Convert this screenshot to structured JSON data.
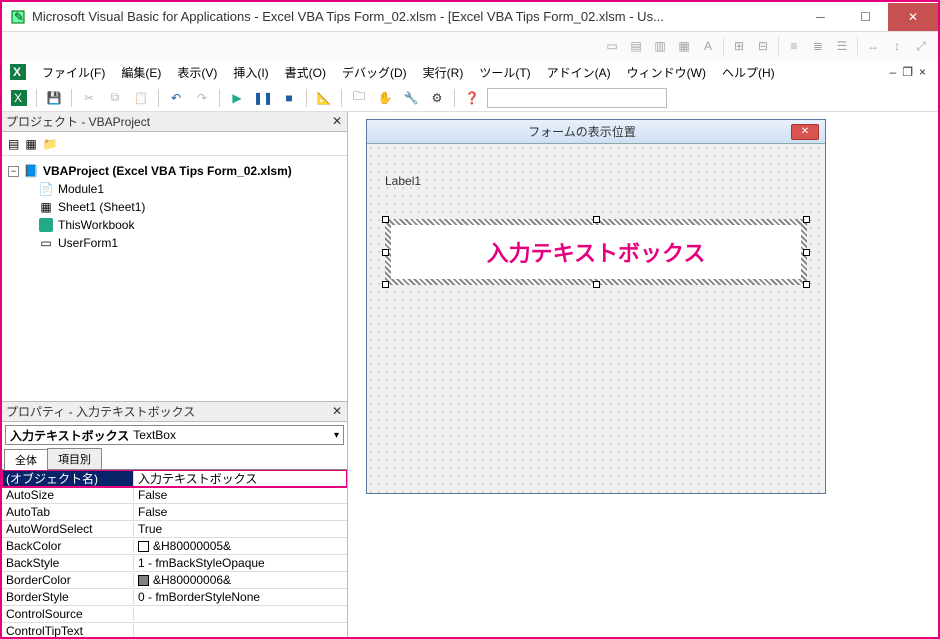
{
  "window": {
    "title": "Microsoft Visual Basic for Applications - Excel VBA Tips Form_02.xlsm - [Excel VBA Tips Form_02.xlsm - Us..."
  },
  "menus": {
    "file": "ファイル(F)",
    "edit": "編集(E)",
    "view": "表示(V)",
    "insert": "挿入(I)",
    "format": "書式(O)",
    "debug": "デバッグ(D)",
    "run": "実行(R)",
    "tools": "ツール(T)",
    "addins": "アドイン(A)",
    "window": "ウィンドウ(W)",
    "help": "ヘルプ(H)"
  },
  "project_panel": {
    "title": "プロジェクト - VBAProject",
    "root": "VBAProject (Excel VBA Tips Form_02.xlsm)",
    "children": [
      "Module1",
      "Sheet1 (Sheet1)",
      "ThisWorkbook",
      "UserForm1"
    ]
  },
  "props_panel": {
    "title": "プロパティ - 入力テキストボックス",
    "combo_name": "入力テキストボックス",
    "combo_type": "TextBox",
    "tabs": {
      "all": "全体",
      "cat": "項目別"
    },
    "rows": [
      {
        "name": "(オブジェクト名)",
        "value": "入力テキストボックス",
        "highlight": true
      },
      {
        "name": "AutoSize",
        "value": "False"
      },
      {
        "name": "AutoTab",
        "value": "False"
      },
      {
        "name": "AutoWordSelect",
        "value": "True"
      },
      {
        "name": "BackColor",
        "value": "&H80000005&",
        "swatch": "#ffffff"
      },
      {
        "name": "BackStyle",
        "value": "1 - fmBackStyleOpaque"
      },
      {
        "name": "BorderColor",
        "value": "&H80000006&",
        "swatch": "#808080"
      },
      {
        "name": "BorderStyle",
        "value": "0 - fmBorderStyleNone"
      },
      {
        "name": "ControlSource",
        "value": ""
      },
      {
        "name": "ControlTipText",
        "value": ""
      }
    ]
  },
  "form": {
    "title": "フォームの表示位置",
    "label1": "Label1",
    "textbox_text": "入力テキストボックス"
  }
}
